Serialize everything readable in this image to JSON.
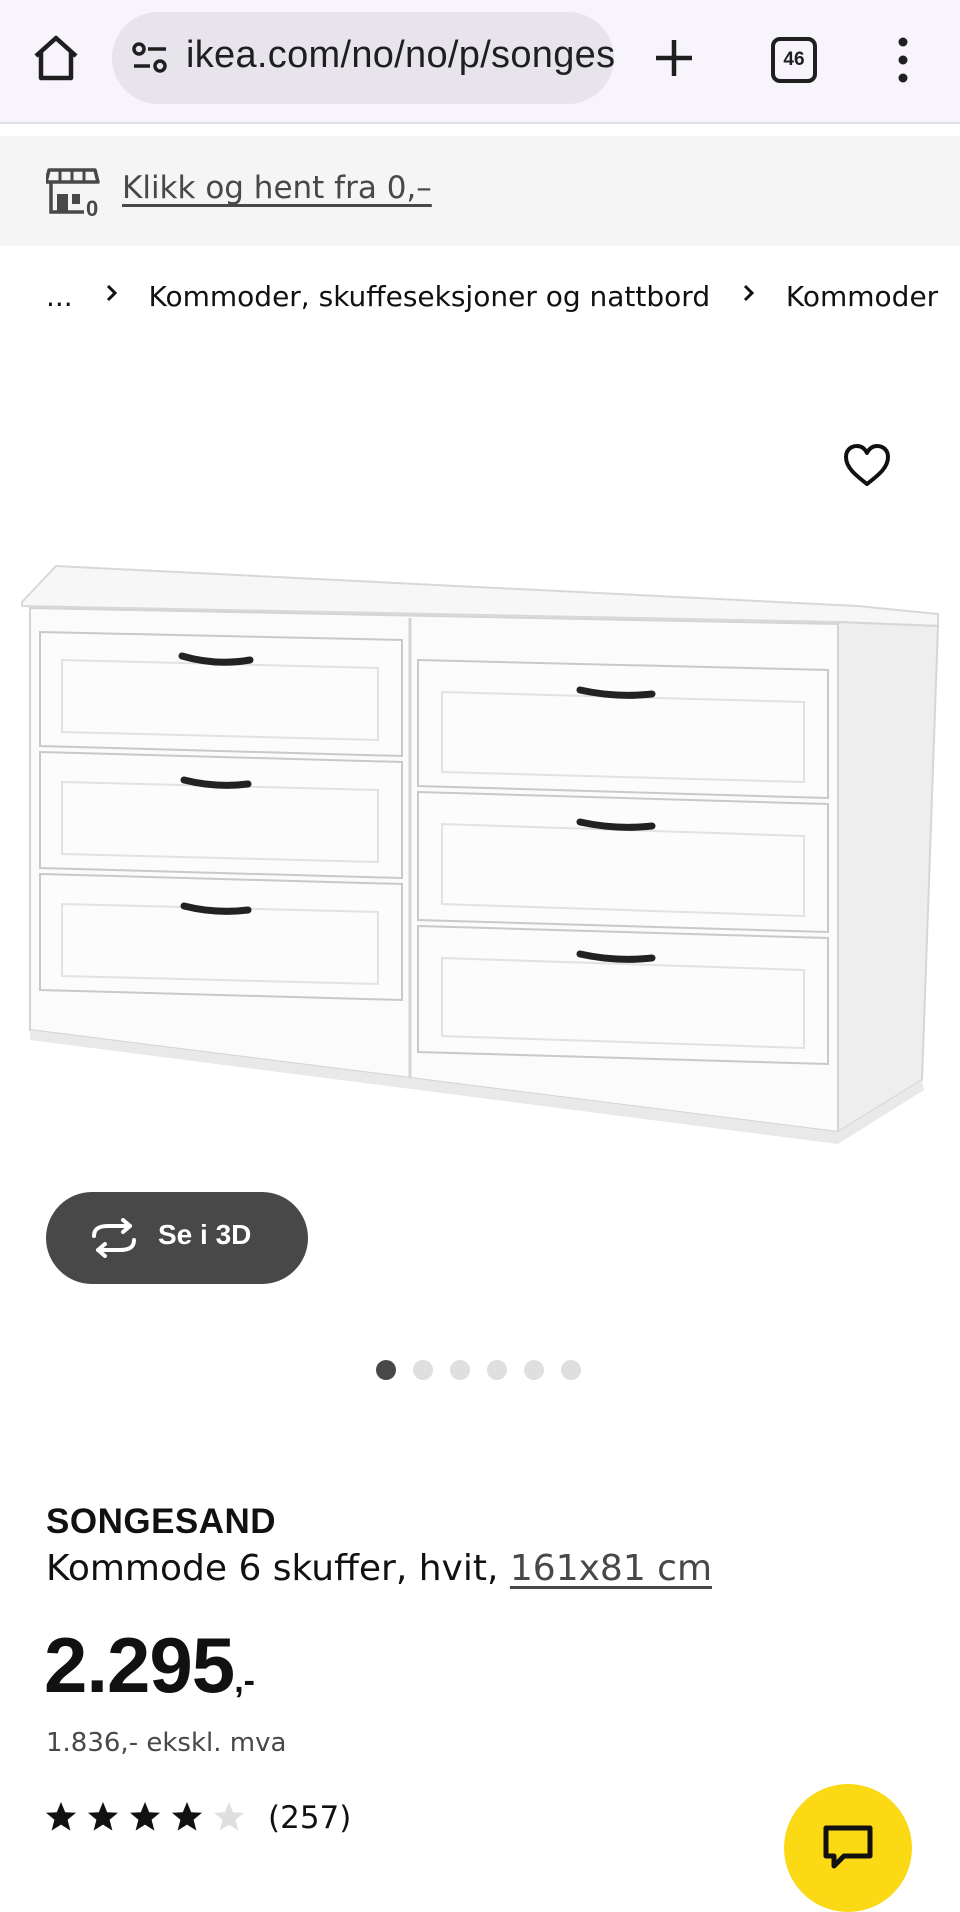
{
  "browser": {
    "url": "ikea.com/no/no/p/songesand",
    "tab_count": "46"
  },
  "promo": {
    "text": "Klikk og hent fra 0,–"
  },
  "breadcrumb": {
    "ellipsis": "...",
    "items": [
      "Kommoder, skuffeseksjoner og nattbord",
      "Kommoder"
    ]
  },
  "gallery": {
    "view_3d_label": "Se i 3D",
    "image_count": 6,
    "active_index": 0
  },
  "product": {
    "name": "SONGESAND",
    "description": "Kommode 6 skuffer, hvit,",
    "size": "161x81 cm",
    "price": "2.295",
    "price_suffix": ",-",
    "price_ex_vat": "1.836,- ekskl. mva",
    "rating_stars": 4,
    "rating_max": 5,
    "review_count": "(257)"
  },
  "colors": {
    "chrome_bg": "#f8f4fb",
    "button_dark": "#484848",
    "chat_yellow": "#fbd914"
  }
}
